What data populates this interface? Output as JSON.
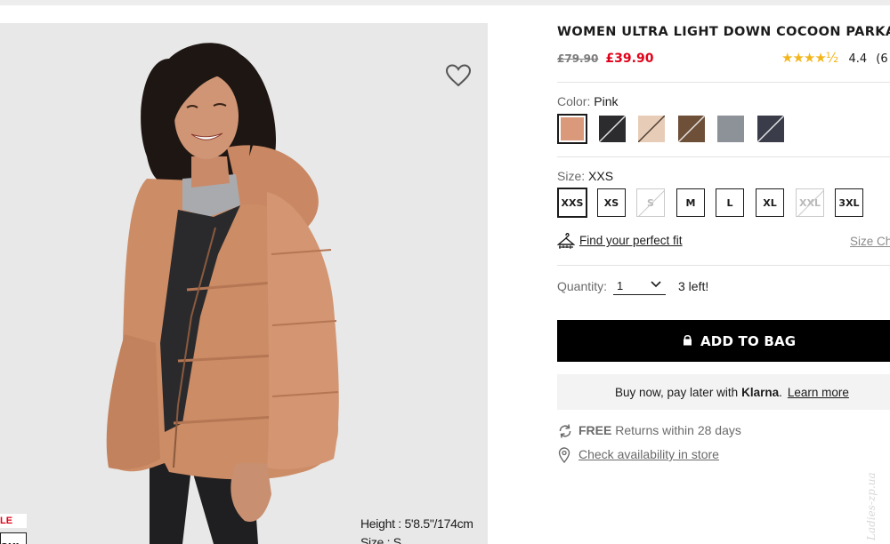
{
  "product": {
    "title": "WOMEN ULTRA LIGHT DOWN COCOON PARKA",
    "old_price": "£79.90",
    "new_price": "£39.90",
    "rating": {
      "stars": "★★★★½",
      "value": "4.4",
      "count": "(6"
    }
  },
  "image": {
    "badge_sale": "LE",
    "badge_size": "3XL",
    "model_height": "Height : 5'8.5\"/174cm",
    "model_size": "Size : S"
  },
  "color": {
    "label": "Color:",
    "selected": "Pink",
    "swatches": [
      {
        "name": "Pink",
        "hex": "#d9997a",
        "available": true,
        "selected": true
      },
      {
        "name": "Black",
        "hex": "#2c2c2e",
        "available": false
      },
      {
        "name": "Beige",
        "hex": "#e7cdb7",
        "available": false
      },
      {
        "name": "Brown",
        "hex": "#6e4f38",
        "available": false
      },
      {
        "name": "Grey",
        "hex": "#8d9198",
        "available": true
      },
      {
        "name": "Navy",
        "hex": "#3a3c4a",
        "available": false
      }
    ]
  },
  "size": {
    "label": "Size:",
    "selected": "XXS",
    "options": [
      {
        "label": "XXS",
        "available": true,
        "selected": true
      },
      {
        "label": "XS",
        "available": true
      },
      {
        "label": "S",
        "available": false
      },
      {
        "label": "M",
        "available": true
      },
      {
        "label": "L",
        "available": true
      },
      {
        "label": "XL",
        "available": true
      },
      {
        "label": "XXL",
        "available": false
      },
      {
        "label": "3XL",
        "available": true
      }
    ],
    "fit_link": "Find your perfect fit",
    "chart_link": "Size Ch"
  },
  "quantity": {
    "label": "Quantity:",
    "value": "1",
    "stock": "3 left!"
  },
  "cta": {
    "add_to_bag": "ADD TO BAG"
  },
  "klarna": {
    "text": "Buy now, pay later with",
    "brand": "Klarna",
    "dot": ".",
    "learn_more": "Learn more"
  },
  "returns": {
    "free": "FREE",
    "text": "Returns within 28 days"
  },
  "store": {
    "link": "Check availability in store"
  },
  "watermark": "Ladies-zp.ua",
  "colors": {
    "accent_red": "#e0021a",
    "star": "#f2b61c",
    "cta_bg": "#000000"
  }
}
